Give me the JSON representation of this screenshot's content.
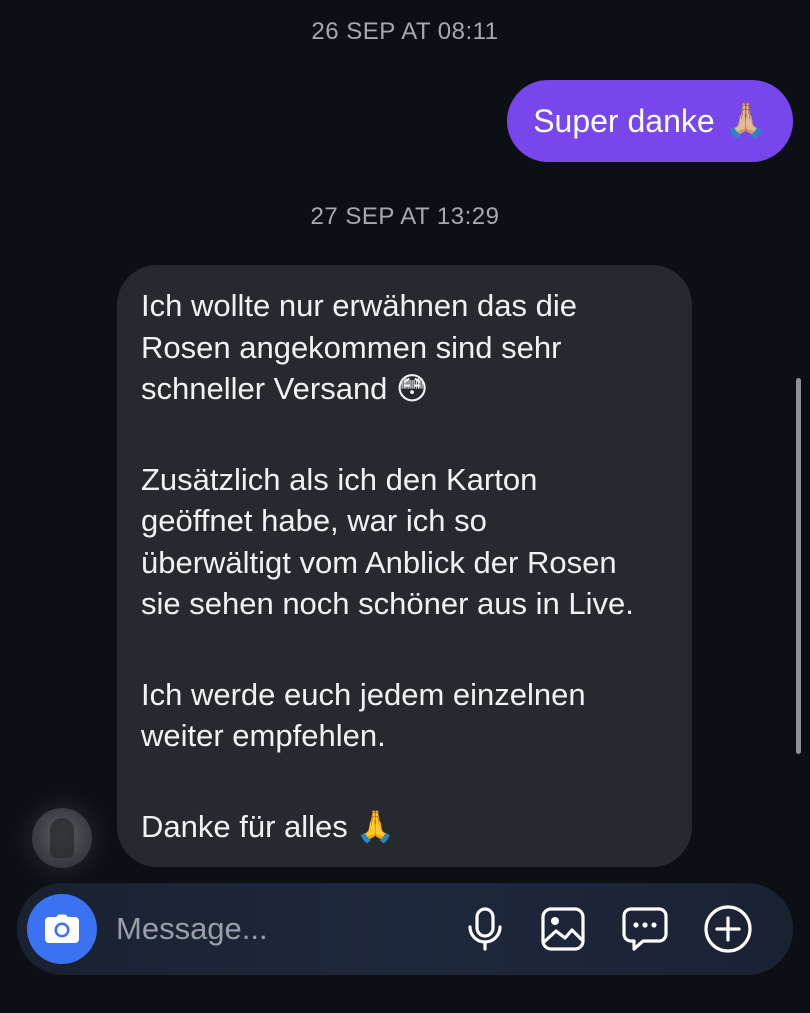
{
  "timestamps": {
    "first": "26 SEP AT 08:11",
    "second": "27 SEP AT 13:29"
  },
  "outgoing": {
    "text": "Super danke",
    "emoji": "🙏🏼",
    "color": "#7747ec"
  },
  "incoming": {
    "paragraphs": [
      {
        "lines": [
          "Ich wollte nur erwähnen das die",
          "Rosen angekommen sind sehr",
          "schneller Versand 😳"
        ]
      },
      {
        "lines": [
          "Zusätzlich als ich den Karton",
          "geöffnet habe, war ich so",
          "überwältigt vom Anblick der Rosen",
          "sie sehen noch schöner aus in Live."
        ]
      },
      {
        "lines": [
          "Ich werde euch jedem einzelnen",
          "weiter empfehlen."
        ]
      },
      {
        "lines": [
          "Danke für alles 🙏"
        ]
      }
    ],
    "color": "#262a2f"
  },
  "composer": {
    "placeholder": "Message...",
    "camera_color": "#3a72f2",
    "icons": [
      "camera-icon",
      "microphone-icon",
      "gallery-icon",
      "sticker-icon",
      "plus-icon"
    ]
  }
}
